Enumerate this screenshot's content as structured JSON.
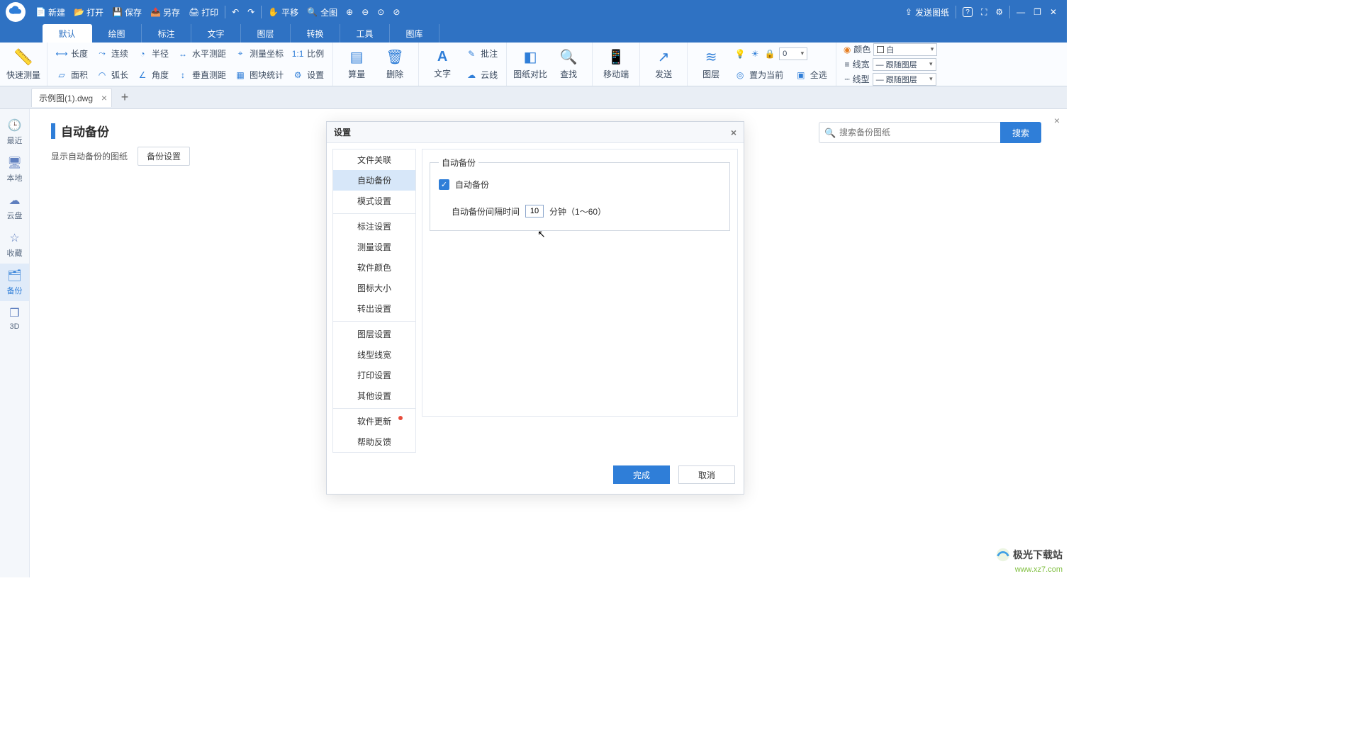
{
  "titlebar": {
    "new": "新建",
    "open": "打开",
    "save": "保存",
    "saveas": "另存",
    "print": "打印",
    "pan": "平移",
    "fit": "全图",
    "send": "发送图纸"
  },
  "tabs": {
    "default": "默认",
    "draw": "绘图",
    "annotate": "标注",
    "text": "文字",
    "layer": "图层",
    "convert": "转换",
    "tools": "工具",
    "gallery": "图库"
  },
  "ribbon": {
    "quick": "快速测量",
    "col1": {
      "length": "长度",
      "area": "面积"
    },
    "col2": {
      "continuous": "连续",
      "arc": "弧长"
    },
    "col3": {
      "radius": "半径",
      "angle": "角度"
    },
    "col4": {
      "hdist": "水平测距",
      "vdist": "垂直测距"
    },
    "col5": {
      "coord": "测量坐标",
      "blockstat": "图块统计"
    },
    "col6": {
      "ratio": "比例",
      "settings": "设置"
    },
    "calc": "算量",
    "delete": "删除",
    "textbig": "文字",
    "anno": "批注",
    "cloud": "云线",
    "compare": "图纸对比",
    "find": "查找",
    "mobile": "移动端",
    "send": "发送",
    "layers": "图层",
    "setascurrent": "置为当前",
    "selectall": "全选",
    "color_lbl": "颜色",
    "width_lbl": "线宽",
    "type_lbl": "线型",
    "color_val": "白",
    "width_val": "跟随图层",
    "type_val": "跟随图层"
  },
  "doc_tab": "示例图(1).dwg",
  "rail": {
    "recent": "最近",
    "local": "本地",
    "cloud": "云盘",
    "favorite": "收藏",
    "backup": "备份",
    "three_d": "3D"
  },
  "page": {
    "title": "自动备份",
    "subtitle": "显示自动备份的图纸",
    "btn": "备份设置"
  },
  "search": {
    "placeholder": "搜索备份图纸",
    "btn": "搜索"
  },
  "dialog": {
    "title": "设置",
    "nav": [
      "文件关联",
      "自动备份",
      "模式设置",
      "标注设置",
      "测量设置",
      "软件颜色",
      "图标大小",
      "转出设置",
      "图层设置",
      "线型线宽",
      "打印设置",
      "其他设置",
      "软件更新",
      "帮助反馈"
    ],
    "fieldset": "自动备份",
    "chk_label": "自动备份",
    "interval_label": "自动备份间隔时间",
    "interval_value": "10",
    "interval_unit": "分钟（1～60）",
    "ok": "完成",
    "cancel": "取消"
  },
  "watermark": {
    "brand": "极光下载站",
    "url": "www.xz7.com"
  }
}
